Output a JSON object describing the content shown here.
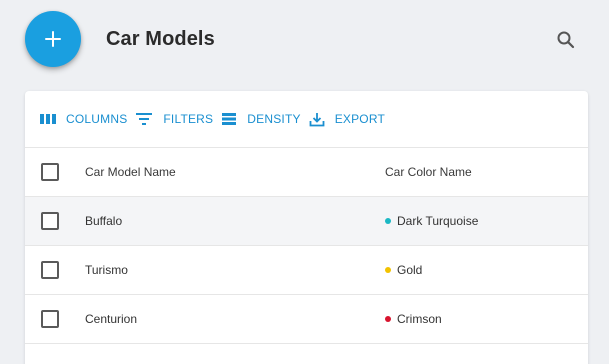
{
  "header": {
    "title": "Car Models"
  },
  "toolbar": {
    "columns_label": "COLUMNS",
    "filters_label": "FILTERS",
    "density_label": "DENSITY",
    "export_label": "EXPORT"
  },
  "table": {
    "columns": [
      "Car Model Name",
      "Car Color Name"
    ],
    "rows": [
      {
        "name": "Buffalo",
        "color": "Dark Turquoise",
        "dot": "#1ab8c4"
      },
      {
        "name": "Turismo",
        "color": "Gold",
        "dot": "#f2c200"
      },
      {
        "name": "Centurion",
        "color": "Crimson",
        "dot": "#d8142e"
      }
    ]
  },
  "colors": {
    "accent": "#1a9fe0",
    "toolbar_text": "#1a8fd0"
  }
}
